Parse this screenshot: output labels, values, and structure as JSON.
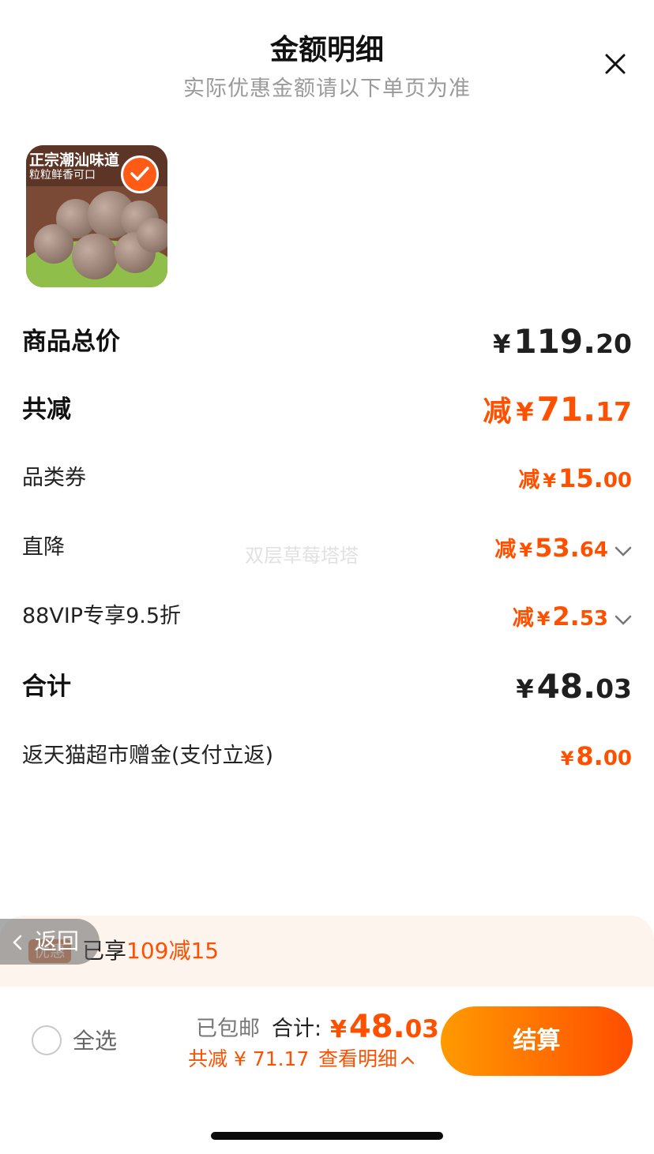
{
  "sheet": {
    "title": "金额明细",
    "subtitle": "实际优惠金额请以下单页为准"
  },
  "product": {
    "banner_title": "正宗潮汕味道",
    "banner_subtitle": "粒粒鲜香可口",
    "selected": true
  },
  "rows": {
    "goods_total": {
      "label": "商品总价",
      "yen": "¥",
      "int": "119.",
      "dec": "20"
    },
    "total_reduce": {
      "label": "共减",
      "prefix": "减",
      "yen": "¥",
      "int": "71.",
      "dec": "17"
    },
    "category_coupon": {
      "label": "品类券",
      "prefix": "减",
      "yen": "¥",
      "int": "15.",
      "dec": "00"
    },
    "direct_drop": {
      "label": "直降",
      "prefix": "减",
      "yen": "¥",
      "int": "53.",
      "dec": "64"
    },
    "vip_discount": {
      "label": "88VIP专享9.5折",
      "prefix": "减",
      "yen": "¥",
      "int": "2.",
      "dec": "53"
    },
    "sum": {
      "label": "合计",
      "yen": "¥",
      "int": "48.",
      "dec": "03"
    },
    "cashback": {
      "label": "返天猫超市赠金(支付立返)",
      "yen": "¥",
      "int": "8.",
      "dec": "00"
    }
  },
  "watermark": "双层草莓塔塔",
  "promo": {
    "tag": "优惠",
    "text_prefix": "已享",
    "text_highlight": "109减15"
  },
  "back_button": {
    "label": "返回"
  },
  "footer": {
    "select_all": "全选",
    "shipping": "已包邮",
    "total_label": "合计:",
    "total_yen": "¥",
    "total_int": "48.",
    "total_dec": "03",
    "saved_text": "共减 ¥ 71.17",
    "detail_link": "查看明细",
    "checkout": "结算"
  },
  "colors": {
    "accent": "#ff5000",
    "button_start": "#ff9a00",
    "button_end": "#ff4d00",
    "promo_bg": "#fdf4ee"
  }
}
